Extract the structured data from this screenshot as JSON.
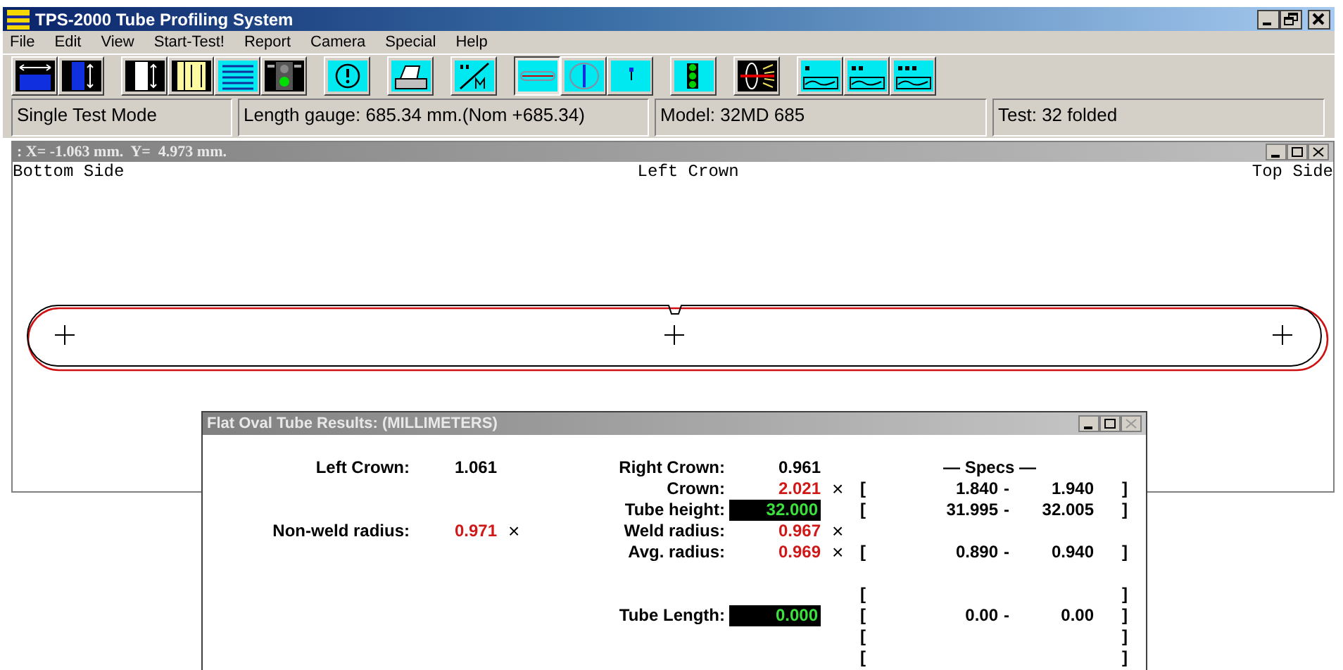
{
  "window": {
    "title": "TPS-2000 Tube Profiling System"
  },
  "menu": [
    {
      "label": "File"
    },
    {
      "label": "Edit"
    },
    {
      "label": "View"
    },
    {
      "label": "Start-Test!"
    },
    {
      "label": "Report"
    },
    {
      "label": "Camera"
    },
    {
      "label": "Special"
    },
    {
      "label": "Help"
    }
  ],
  "toolbar_groups": [
    [
      {
        "kind": "gauge",
        "pressed": false
      },
      {
        "kind": "bluebar",
        "pressed": false
      }
    ],
    [
      {
        "kind": "whitebar",
        "pressed": false
      },
      {
        "kind": "yellowbars",
        "pressed": false
      },
      {
        "kind": "list",
        "pressed": false
      },
      {
        "kind": "traffic",
        "pressed": false
      }
    ],
    [
      {
        "kind": "alert",
        "pressed": false
      }
    ],
    [
      {
        "kind": "printer",
        "pressed": false
      }
    ],
    [
      {
        "kind": "units",
        "pressed": false
      }
    ],
    [
      {
        "kind": "hview",
        "pressed": true
      },
      {
        "kind": "vview",
        "pressed": false
      },
      {
        "kind": "pin",
        "pressed": false
      }
    ],
    [
      {
        "kind": "dots",
        "pressed": false
      }
    ],
    [
      {
        "kind": "laser",
        "pressed": false
      }
    ],
    [
      {
        "kind": "graph1",
        "pressed": false
      },
      {
        "kind": "graph2",
        "pressed": false
      },
      {
        "kind": "graph3",
        "pressed": false
      }
    ]
  ],
  "status_fields": [
    "Single Test Mode",
    "Length gauge: 685.34 mm.(Nom +685.34)",
    "Model: 32MD 685",
    "Test: 32 folded"
  ],
  "profile_window": {
    "title": ": X= -1.063 mm.  Y=  4.973 mm.",
    "labels": [
      "Bottom Side",
      "Left Crown",
      "Top Side"
    ]
  },
  "results_dialog": {
    "title": "Flat Oval Tube Results: (MILLIMETERS)",
    "rows": [
      {
        "left": {
          "label": "Left Crown:",
          "value": "1.061",
          "out_of_spec": false,
          "display": false
        },
        "center": {
          "label": "Right Crown:",
          "value": "0.961",
          "out_of_spec": false,
          "display": false
        },
        "spec": {
          "kind": "heading",
          "text": "— Specs —"
        }
      },
      {
        "center": {
          "label": "Crown:",
          "value": "2.021",
          "out_of_spec": true,
          "flag": "×",
          "display": false
        },
        "spec": {
          "kind": "range",
          "open": "[",
          "low": "1.840",
          "sep": "-",
          "high": "1.940",
          "close": "]"
        }
      },
      {
        "center": {
          "label": "Tube height:",
          "value": "32.000",
          "out_of_spec": false,
          "display": true
        },
        "spec": {
          "kind": "range",
          "open": "[",
          "low": "31.995",
          "sep": "-",
          "high": "32.005",
          "close": "]"
        }
      },
      {
        "left": {
          "label": "Non-weld radius:",
          "value": "0.971",
          "out_of_spec": true,
          "flag": "×",
          "display": false
        },
        "center": {
          "label": "Weld radius:",
          "value": "0.967",
          "out_of_spec": true,
          "flag": "×",
          "display": false
        }
      },
      {
        "center": {
          "label": "Avg. radius:",
          "value": "0.969",
          "out_of_spec": true,
          "flag": "×",
          "display": false
        },
        "spec": {
          "kind": "range",
          "open": "[",
          "low": "0.890",
          "sep": "-",
          "high": "0.940",
          "close": "]"
        }
      },
      {},
      {
        "spec": {
          "kind": "brackets",
          "open": "[",
          "close": "]"
        }
      },
      {
        "center": {
          "label": "Tube Length:",
          "value": "0.000",
          "out_of_spec": false,
          "display": true
        },
        "spec": {
          "kind": "range",
          "open": "[",
          "low": "0.00",
          "sep": "-",
          "high": "0.00",
          "close": "]"
        }
      },
      {
        "spec": {
          "kind": "brackets",
          "open": "[",
          "close": "]"
        }
      },
      {
        "spec": {
          "kind": "brackets",
          "open": "[",
          "close": "]"
        }
      }
    ]
  }
}
